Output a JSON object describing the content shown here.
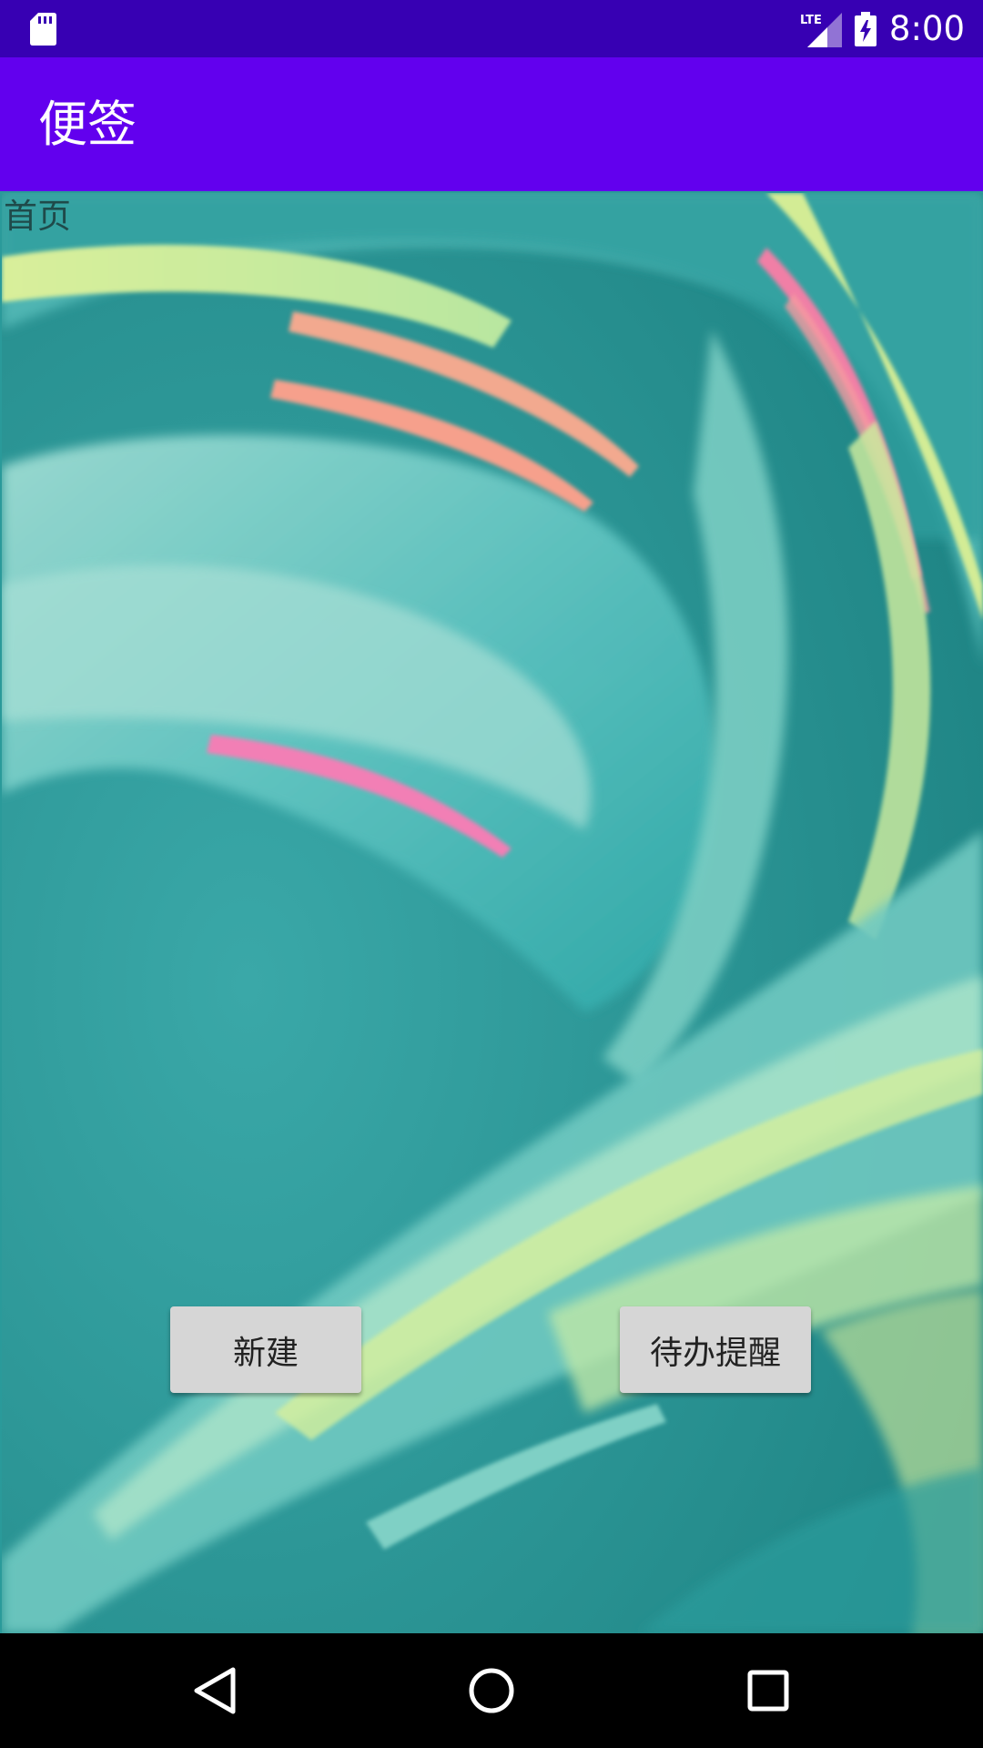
{
  "status_bar": {
    "time": "8:00",
    "network": "LTE",
    "icons": [
      "sd-card-icon",
      "lte-signal-icon",
      "battery-charging-icon"
    ]
  },
  "app_bar": {
    "title": "便签"
  },
  "content": {
    "page_label": "首页",
    "buttons": {
      "new": "新建",
      "todo": "待办提醒"
    }
  },
  "nav_bar": {
    "icons": [
      "back-icon",
      "home-icon",
      "recents-icon"
    ]
  },
  "colors": {
    "status_bar": "#3700B3",
    "app_bar": "#6200EE",
    "button_bg": "#d6d6d6",
    "nav_bar": "#000000"
  }
}
